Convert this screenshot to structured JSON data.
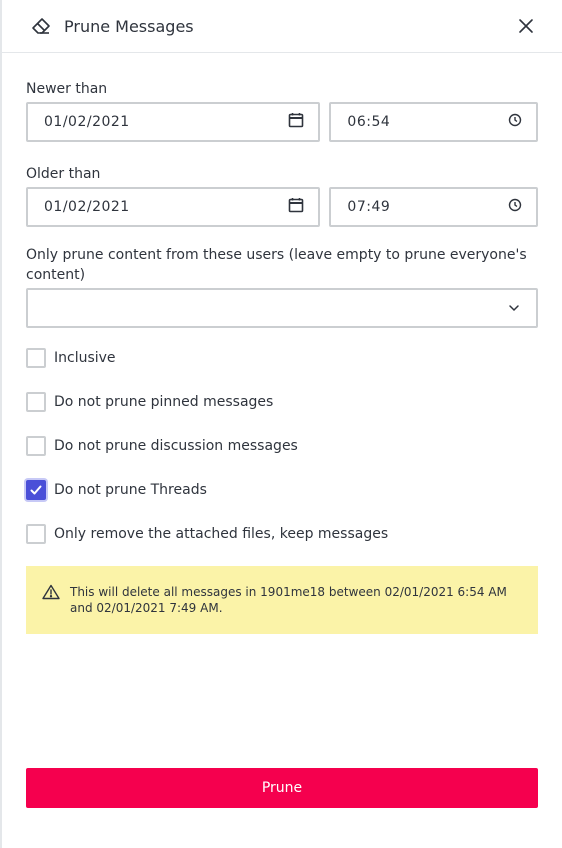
{
  "header": {
    "title": "Prune Messages",
    "icon": "eraser-icon",
    "close_icon": "close-icon"
  },
  "newer": {
    "label": "Newer than",
    "date": "01/02/2021",
    "time": "06:54"
  },
  "older": {
    "label": "Older than",
    "date": "01/02/2021",
    "time": "07:49"
  },
  "users": {
    "label": "Only prune content from these users (leave empty to prune everyone's content)",
    "value": ""
  },
  "checkboxes": [
    {
      "label": "Inclusive",
      "checked": false
    },
    {
      "label": "Do not prune pinned messages",
      "checked": false
    },
    {
      "label": "Do not prune discussion messages",
      "checked": false
    },
    {
      "label": "Do not prune Threads",
      "checked": true
    },
    {
      "label": "Only remove the attached files, keep messages",
      "checked": false
    }
  ],
  "warning": {
    "text": "This will delete all messages in 1901me18 between 02/01/2021 6:54 AM and 02/01/2021 7:49 AM.",
    "icon": "warning-icon"
  },
  "actions": {
    "prune_label": "Prune"
  },
  "colors": {
    "accent": "#4a4fd8",
    "danger": "#f5004e",
    "warning_bg": "#fbf3a8",
    "border": "#cbced1"
  }
}
